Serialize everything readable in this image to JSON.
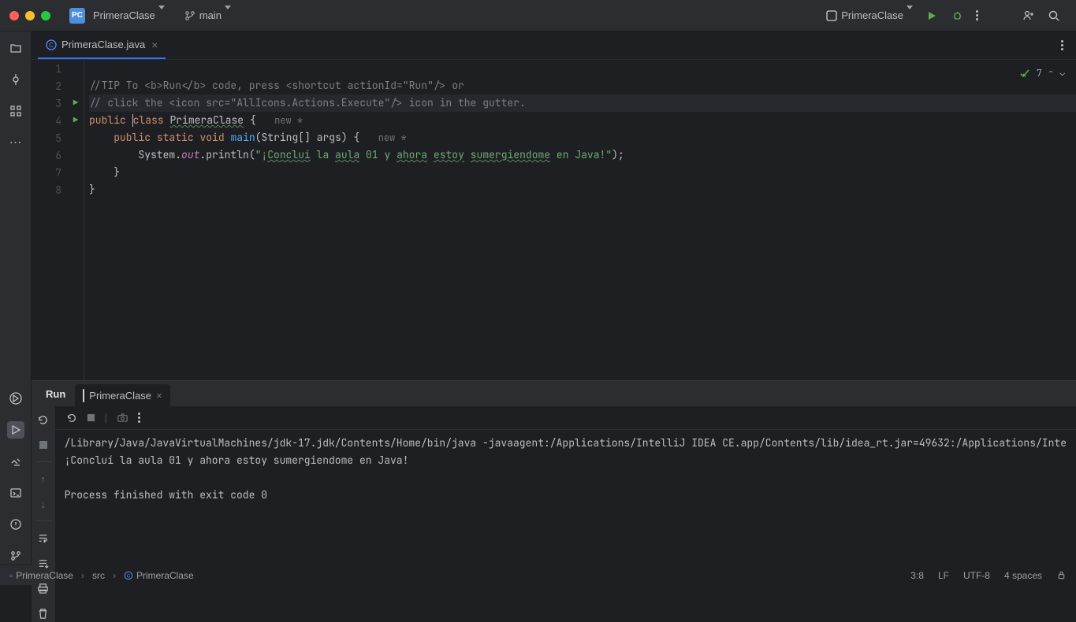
{
  "titlebar": {
    "project_badge": "PC",
    "project_name": "PrimeraClase",
    "branch_name": "main",
    "run_config": "PrimeraClase"
  },
  "tabs": {
    "file_name": "PrimeraClase.java"
  },
  "gutter": {
    "ln": [
      "1",
      "2",
      "3",
      "4",
      "5",
      "6",
      "7",
      "8"
    ]
  },
  "code": {
    "l1": "//TIP To <b>Run</b> code, press <shortcut actionId=\"Run\"/> or",
    "l2": "// click the <icon src=\"AllIcons.Actions.Execute\"/> icon in the gutter.",
    "l3_kw1": "public",
    "l3_kw2": "class",
    "l3_name": "PrimeraClase",
    "l3_brace": " {",
    "l3_hint": "new *",
    "l4_kw1": "public",
    "l4_kw2": "static",
    "l4_kw3": "void",
    "l4_method": "main",
    "l4_params": "(String[] args) {",
    "l4_hint": "new *",
    "l5_a": "        System.",
    "l5_out": "out",
    "l5_b": ".println(",
    "l5_s1": "\"¡",
    "l5_t1": "Concluí",
    "l5_s2": " la ",
    "l5_t2": "aula",
    "l5_s3": " 01 y ",
    "l5_t3": "ahora",
    "l5_s4": " ",
    "l5_t4": "estoy",
    "l5_s5": " ",
    "l5_t5": "sumergiendome",
    "l5_s6": " en Java!\"",
    "l5_end": ");",
    "l6": "    }",
    "l7": "}"
  },
  "inspections": {
    "count": "7"
  },
  "run": {
    "tab_label": "Run",
    "item_name": "PrimeraClase",
    "out_line1": "/Library/Java/JavaVirtualMachines/jdk-17.jdk/Contents/Home/bin/java -javaagent:/Applications/IntelliJ IDEA CE.app/Contents/lib/idea_rt.jar=49632:/Applications/Inte",
    "out_line2": "¡Concluí la aula 01 y ahora estoy sumergiendome en Java!",
    "out_line3": "",
    "out_line4": "Process finished with exit code 0"
  },
  "status": {
    "crumb1": "PrimeraClase",
    "crumb2": "src",
    "crumb3": "PrimeraClase",
    "pos": "3:8",
    "sep": "LF",
    "enc": "UTF-8",
    "indent": "4 spaces"
  }
}
